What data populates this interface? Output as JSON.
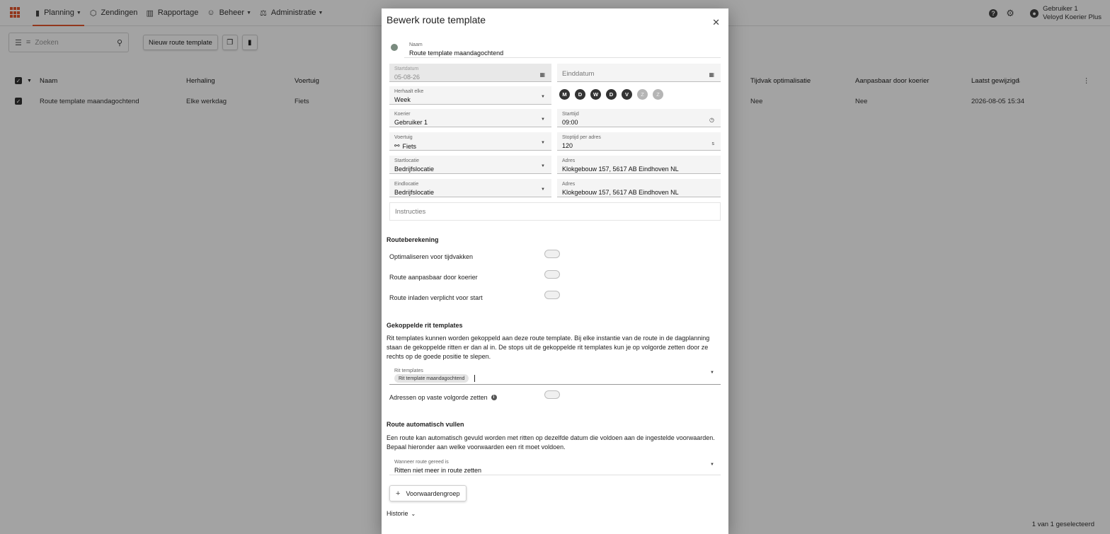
{
  "appbar": {
    "nav": [
      {
        "label": "Planning",
        "icon": "map-icon",
        "glyph": "▮",
        "caret": true
      },
      {
        "label": "Zendingen",
        "icon": "package-icon",
        "glyph": "⬡",
        "caret": false
      },
      {
        "label": "Rapportage",
        "icon": "bar-chart-icon",
        "glyph": "▥",
        "caret": false
      },
      {
        "label": "Beheer",
        "icon": "people-icon",
        "glyph": "👥",
        "caret": true
      },
      {
        "label": "Administratie",
        "icon": "admin-icon",
        "glyph": "⚖",
        "caret": true
      }
    ],
    "user_name": "Gebruiker 1",
    "company": "Veloyd Koerier Plus",
    "accent": "#e4572e"
  },
  "toolbar": {
    "search_placeholder": "Zoeken",
    "new_button": "Nieuw route template"
  },
  "table": {
    "columns": [
      "Naam",
      "Herhaling",
      "Voertuig",
      "Tijdvak optimalisatie",
      "Aanpasbaar door koerier",
      "Laatst gewijzigd"
    ],
    "rows": [
      {
        "naam": "Route template maandagochtend",
        "herhaling": "Elke werkdag",
        "voertuig": "Fiets",
        "tijdvak": "Nee",
        "aanpasbaar": "Nee",
        "gewijzigd": "2026-08-05 15:34"
      }
    ],
    "selected_count": "1 van 1 geselecteerd"
  },
  "dialog": {
    "title": "Bewerk route template",
    "naam": {
      "label": "Naam",
      "value": "Route template maandagochtend"
    },
    "startdatum": {
      "label": "Startdatum",
      "value": "05-08-26"
    },
    "einddatum": {
      "label": "Einddatum"
    },
    "herhaal": {
      "label": "Herhaalt elke",
      "value": "Week"
    },
    "days": [
      {
        "label": "M",
        "active": true
      },
      {
        "label": "D",
        "active": true
      },
      {
        "label": "W",
        "active": true
      },
      {
        "label": "D",
        "active": true
      },
      {
        "label": "V",
        "active": true
      },
      {
        "label": "Z",
        "active": false
      },
      {
        "label": "Z",
        "active": false
      }
    ],
    "koerier": {
      "label": "Koerier",
      "value": "Gebruiker 1"
    },
    "starttijd": {
      "label": "Starttijd",
      "value": "09:00"
    },
    "voertuig": {
      "label": "Voertuig",
      "value": "Fiets"
    },
    "stoptijd": {
      "label": "Stoptijd per adres",
      "value": "120",
      "unit": "s"
    },
    "startlocatie": {
      "label": "Startlocatie",
      "value": "Bedrijfslocatie"
    },
    "start_adres": {
      "label": "Adres",
      "value": "Klokgebouw 157, 5617 AB Eindhoven NL"
    },
    "eindlocatie": {
      "label": "Eindlocatie",
      "value": "Bedrijfslocatie"
    },
    "eind_adres": {
      "label": "Adres",
      "value": "Klokgebouw 157, 5617 AB Eindhoven NL"
    },
    "instructies": {
      "placeholder": "Instructies"
    },
    "routeberekening": {
      "title": "Routeberekening",
      "toggles": [
        {
          "label": "Optimaliseren voor tijdvakken",
          "on": false
        },
        {
          "label": "Route aanpasbaar door koerier",
          "on": false
        },
        {
          "label": "Route inladen verplicht voor start",
          "on": false
        }
      ]
    },
    "gekoppeld": {
      "title": "Gekoppelde rit templates",
      "text": "Rit templates kunnen worden gekoppeld aan deze route template. Bij elke instantie van de route in de dagplanning staan de gekoppelde ritten er dan al in. De stops uit de gekoppelde rit templates kun je op volgorde zetten door ze rechts op de goede positie te slepen.",
      "rit_label": "Rit templates",
      "chip": "Rit template maandagochtend",
      "vaste_volgorde": "Adressen op vaste volgorde zetten"
    },
    "automatisch": {
      "title": "Route automatisch vullen",
      "text": "Een route kan automatisch gevuld worden met ritten op dezelfde datum die voldoen aan de ingestelde voorwaarden. Bepaal hieronder aan welke voorwaarden een rit moet voldoen.",
      "wanneer_label": "Wanneer route gereed is",
      "wanneer_value": "Ritten niet meer in route zetten",
      "add_button": "Voorwaardengroep"
    },
    "historie": "Historie"
  }
}
